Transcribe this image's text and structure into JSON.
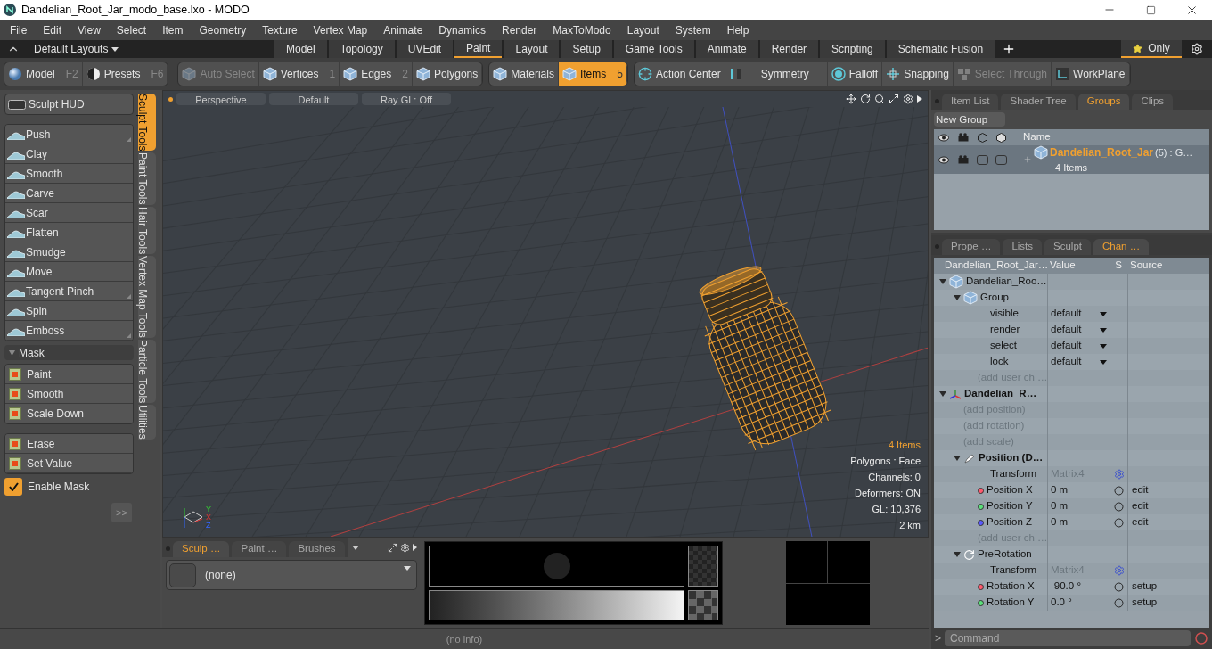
{
  "window": {
    "title": "Dandelian_Root_Jar_modo_base.lxo - MODO"
  },
  "menu": [
    "File",
    "Edit",
    "View",
    "Select",
    "Item",
    "Geometry",
    "Texture",
    "Vertex Map",
    "Animate",
    "Dynamics",
    "Render",
    "MaxToModo",
    "Layout",
    "System",
    "Help"
  ],
  "layout_bar": {
    "layouts_label": "Default Layouts",
    "only_label": "Only",
    "tabs": [
      {
        "label": "Model",
        "selected": false
      },
      {
        "label": "Topology",
        "selected": false
      },
      {
        "label": "UVEdit",
        "selected": false
      },
      {
        "label": "Paint",
        "selected": true
      },
      {
        "label": "Layout",
        "selected": false
      },
      {
        "label": "Setup",
        "selected": false
      },
      {
        "label": "Game Tools",
        "selected": false
      },
      {
        "label": "Animate",
        "selected": false
      },
      {
        "label": "Render",
        "selected": false
      },
      {
        "label": "Scripting",
        "selected": false
      },
      {
        "label": "Schematic Fusion",
        "selected": false
      }
    ]
  },
  "toolbar": {
    "groups": [
      [
        {
          "label": "Model",
          "key": "F2",
          "kind": "sphere",
          "selected": false,
          "disabled": false
        },
        {
          "label": "Presets",
          "key": "F6",
          "kind": "presets",
          "selected": false,
          "disabled": false
        }
      ],
      [
        {
          "label": "Auto Select",
          "kind": "cube",
          "selected": false,
          "disabled": true
        },
        {
          "label": "Vertices",
          "key": "1",
          "kind": "cube",
          "selected": false,
          "disabled": false
        },
        {
          "label": "Edges",
          "key": "2",
          "kind": "cube",
          "selected": false,
          "disabled": false
        },
        {
          "label": "Polygons",
          "kind": "cube",
          "selected": false,
          "disabled": false
        }
      ],
      [
        {
          "label": "Materials",
          "kind": "cube",
          "selected": false,
          "disabled": false
        },
        {
          "label": "Items",
          "key": "5",
          "kind": "cube",
          "selected": true,
          "disabled": false
        }
      ],
      [
        {
          "label": "Action Center",
          "kind": "crosshair",
          "selected": false,
          "disabled": false
        },
        {
          "label": "Symmetry",
          "kind": "symmetry",
          "selected": false,
          "disabled": false
        },
        {
          "label": "Falloff",
          "kind": "falloff",
          "selected": false,
          "disabled": false
        },
        {
          "label": "Snapping",
          "kind": "snapping",
          "selected": false,
          "disabled": false
        },
        {
          "label": "Select Through",
          "kind": "select_through",
          "selected": false,
          "disabled": true
        },
        {
          "label": "WorkPlane",
          "kind": "workplane",
          "selected": false,
          "disabled": false
        }
      ]
    ]
  },
  "left_panel": {
    "hud_button": "Sculpt HUD",
    "tools": [
      {
        "label": "Push",
        "submenu": true
      },
      {
        "label": "Clay",
        "submenu": false
      },
      {
        "label": "Smooth",
        "submenu": false
      },
      {
        "label": "Carve",
        "submenu": false
      },
      {
        "label": "Scar",
        "submenu": false
      },
      {
        "label": "Flatten",
        "submenu": false
      },
      {
        "label": "Smudge",
        "submenu": false
      },
      {
        "label": "Move",
        "submenu": false
      },
      {
        "label": "Tangent Pinch",
        "submenu": true
      },
      {
        "label": "Spin",
        "submenu": false
      },
      {
        "label": "Emboss",
        "submenu": true
      }
    ],
    "mask_section": {
      "label": "Mask",
      "expanded": true
    },
    "mask_tools": [
      "Paint",
      "Smooth",
      "Scale Down"
    ],
    "mask_tools_2": [
      "Erase",
      "Set Value"
    ],
    "enable_mask": {
      "label": "Enable Mask",
      "checked": true
    },
    "more_button": ">>",
    "vertical_tabs": [
      {
        "label": "Sculpt Tools",
        "selected": true
      },
      {
        "label": "Paint Tools",
        "selected": false
      },
      {
        "label": "Hair Tools",
        "selected": false
      },
      {
        "label": "Vertex Map Tools",
        "selected": false
      },
      {
        "label": "Particle Tools",
        "selected": false
      },
      {
        "label": "Utilities",
        "selected": false
      }
    ]
  },
  "viewport": {
    "header": [
      "Perspective",
      "Default",
      "Ray GL: Off"
    ],
    "axis_labels": [
      "Y",
      "X",
      "Z"
    ],
    "info": [
      {
        "text": "4 Items",
        "highlight": true
      },
      {
        "text": "Polygons : Face",
        "highlight": false
      },
      {
        "text": "Channels: 0",
        "highlight": false
      },
      {
        "text": "Deformers: ON",
        "highlight": false
      },
      {
        "text": "GL: 10,376",
        "highlight": false
      },
      {
        "text": "2 km",
        "highlight": false
      }
    ]
  },
  "brush_panel": {
    "tabs": [
      {
        "label": "Sculp …",
        "selected": true
      },
      {
        "label": "Paint …",
        "selected": false
      },
      {
        "label": "Brushes",
        "selected": false
      }
    ],
    "preset": "(none)"
  },
  "status_bar": "(no info)",
  "groups_panel": {
    "tabs": [
      {
        "label": "Item List",
        "selected": false
      },
      {
        "label": "Shader Tree",
        "selected": false
      },
      {
        "label": "Groups",
        "selected": true
      },
      {
        "label": "Clips",
        "selected": false
      }
    ],
    "new_group_button": "New Group",
    "name_column": "Name",
    "rows": [
      {
        "name": "Dandelian_Root_Jar",
        "suffix": "(5) : G…",
        "count": "4 Items",
        "selected": true
      }
    ]
  },
  "channels_panel": {
    "tabs": [
      {
        "label": "Prope …",
        "selected": false
      },
      {
        "label": "Lists",
        "selected": false
      },
      {
        "label": "Sculpt",
        "selected": false
      },
      {
        "label": "Chan …",
        "selected": true
      }
    ],
    "columns": [
      "Dandelian_Root_Jar…",
      "Value",
      "S",
      "Source"
    ],
    "tree": [
      {
        "label": "Dandelian_Roo…",
        "kind": "group_item",
        "expanded": true,
        "children": [
          {
            "label": "Group",
            "kind": "group",
            "expanded": true,
            "children": [
              {
                "label": "visible",
                "kind": "enum",
                "value": "default"
              },
              {
                "label": "render",
                "kind": "enum",
                "value": "default"
              },
              {
                "label": "select",
                "kind": "enum",
                "value": "default"
              },
              {
                "label": "lock",
                "kind": "enum",
                "value": "default"
              },
              {
                "label": "(add user ch …",
                "kind": "add"
              }
            ]
          }
        ]
      },
      {
        "label": "Dandelian_R…",
        "kind": "locator",
        "expanded": true,
        "children": [
          {
            "label": "(add position)",
            "kind": "add"
          },
          {
            "label": "(add rotation)",
            "kind": "add"
          },
          {
            "label": "(add scale)",
            "kind": "add"
          },
          {
            "label": "Position (D…",
            "kind": "position",
            "expanded": true,
            "children": [
              {
                "label": "Transform",
                "kind": "matrix",
                "value": "Matrix4"
              },
              {
                "label": "Position X",
                "kind": "channel",
                "color": "#ff5a6e",
                "value": "0 m",
                "source": "edit"
              },
              {
                "label": "Position Y",
                "kind": "channel",
                "color": "#5ae07a",
                "value": "0 m",
                "source": "edit"
              },
              {
                "label": "Position Z",
                "kind": "channel",
                "color": "#5a5aff",
                "value": "0 m",
                "source": "edit"
              },
              {
                "label": "(add user ch …",
                "kind": "add"
              }
            ]
          },
          {
            "label": "PreRotation",
            "kind": "rotation",
            "expanded": true,
            "children": [
              {
                "label": "Transform",
                "kind": "matrix",
                "value": "Matrix4"
              },
              {
                "label": "Rotation X",
                "kind": "channel",
                "color": "#ff5a6e",
                "value": "-90.0 °",
                "source": "setup"
              },
              {
                "label": "Rotation Y",
                "kind": "channel",
                "color": "#5ae07a",
                "value": "0.0 °",
                "source": "setup"
              }
            ]
          }
        ]
      }
    ]
  },
  "command_field": {
    "prompt": ">",
    "placeholder": "Command"
  }
}
